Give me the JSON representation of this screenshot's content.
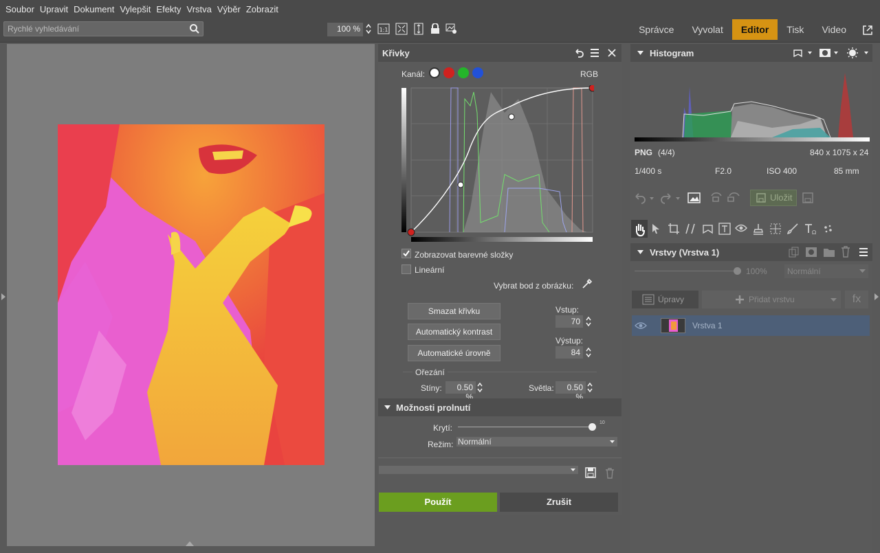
{
  "menu": [
    "Soubor",
    "Upravit",
    "Dokument",
    "Vylepšit",
    "Efekty",
    "Vrstva",
    "Výběr",
    "Zobrazit"
  ],
  "search": {
    "placeholder": "Rychlé vyhledávání"
  },
  "zoom": {
    "value": "100 %"
  },
  "modes": [
    "Správce",
    "Vyvolat",
    "Editor",
    "Tisk",
    "Video"
  ],
  "active_mode": "Editor",
  "curves": {
    "title": "Křivky",
    "channel_label": "Kanál:",
    "channel_value": "RGB",
    "show_components": "Zobrazovat barevné složky",
    "linear": "Lineární",
    "pick_point": "Vybrat bod z obrázku:",
    "clear_curve": "Smazat křivku",
    "auto_contrast": "Automatický kontrast",
    "auto_levels": "Automatické úrovně",
    "input_label": "Vstup:",
    "input_value": "70",
    "output_label": "Výstup:",
    "output_value": "84",
    "clipping": "Ořezání",
    "shadows_label": "Stíny:",
    "shadows_value": "0.50 %",
    "highlights_label": "Světla:",
    "highlights_value": "0.50 %"
  },
  "blend": {
    "title": "Možnosti prolnutí",
    "opacity_label": "Krytí:",
    "opacity_value_text": "10",
    "mode_label": "Režim:",
    "mode_value": "Normální"
  },
  "buttons": {
    "apply": "Použít",
    "cancel": "Zrušit"
  },
  "histogram": {
    "title": "Histogram",
    "format": "PNG",
    "count": "(4/4)",
    "dims": "840 x 1075 x 24",
    "shutter": "1/400 s",
    "aperture": "F2.0",
    "iso": "ISO 400",
    "focal": "85 mm"
  },
  "save_label": "Uložit",
  "layers": {
    "title": "Vrstvy (Vrstva 1)",
    "opacity": "100%",
    "mode": "Normální",
    "adjust": "Úpravy",
    "add_layer": "Přidat vrstvu",
    "fx": "fx",
    "layer_name": "Vrstva 1"
  },
  "colors": {
    "accent": "#d69313",
    "apply": "#6b9e1f",
    "selected_layer": "#4d5f78"
  }
}
